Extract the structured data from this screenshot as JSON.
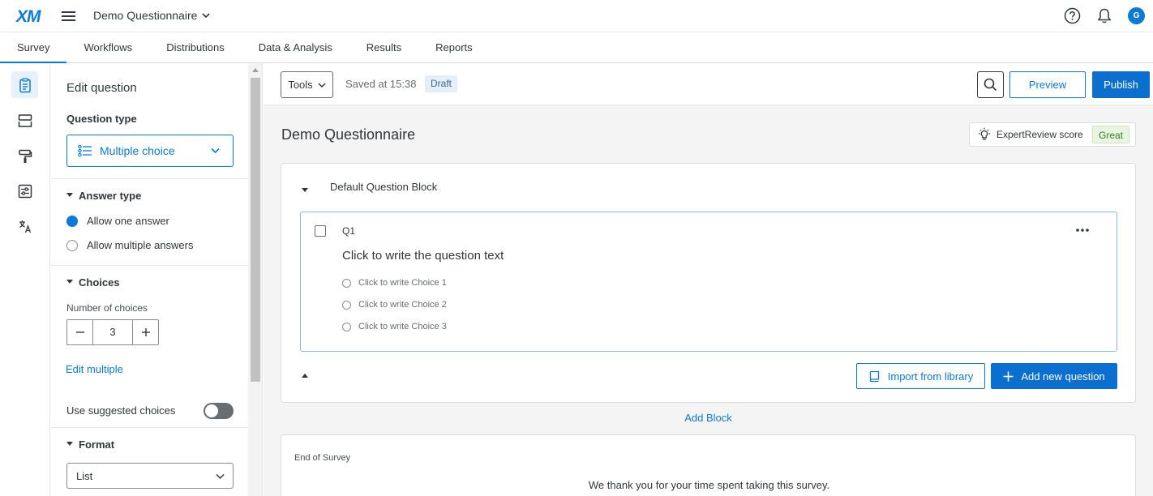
{
  "app": {
    "logo": "XM",
    "survey_title": "Demo Questionnaire",
    "avatar_initial": "G",
    "accent_color": "#0b7bd8"
  },
  "nav": {
    "tabs": [
      "Survey",
      "Workflows",
      "Distributions",
      "Data & Analysis",
      "Results",
      "Reports"
    ],
    "active": "Survey"
  },
  "rail": {
    "icons": [
      "clipboard-icon",
      "blocks-icon",
      "paint-roller-icon",
      "settings-sliders-icon",
      "translate-icon"
    ]
  },
  "edit_panel": {
    "title": "Edit question",
    "question_type_label": "Question type",
    "question_type_value": "Multiple choice",
    "answer_type": {
      "label": "Answer type",
      "options": [
        "Allow one answer",
        "Allow multiple answers"
      ],
      "selected": "Allow one answer"
    },
    "choices": {
      "label": "Choices",
      "number_label": "Number of choices",
      "number_value": "3",
      "edit_multiple": "Edit multiple",
      "suggested_label": "Use suggested choices"
    },
    "format": {
      "label": "Format",
      "value": "List"
    }
  },
  "toolbar": {
    "tools_label": "Tools",
    "saved_text": "Saved at 15:38",
    "status_badge": "Draft",
    "preview_label": "Preview",
    "publish_label": "Publish"
  },
  "survey": {
    "title": "Demo Questionnaire",
    "expert_review_label": "ExpertReview score",
    "expert_review_score": "Great",
    "block_title": "Default Question Block",
    "question": {
      "id": "Q1",
      "text": "Click to write the question text",
      "choices": [
        "Click to write Choice 1",
        "Click to write Choice 2",
        "Click to write Choice 3"
      ]
    },
    "import_label": "Import from library",
    "add_question_label": "Add new question",
    "add_block_label": "Add Block",
    "end_label": "End of Survey",
    "end_message": "We thank you for your time spent taking this survey."
  }
}
